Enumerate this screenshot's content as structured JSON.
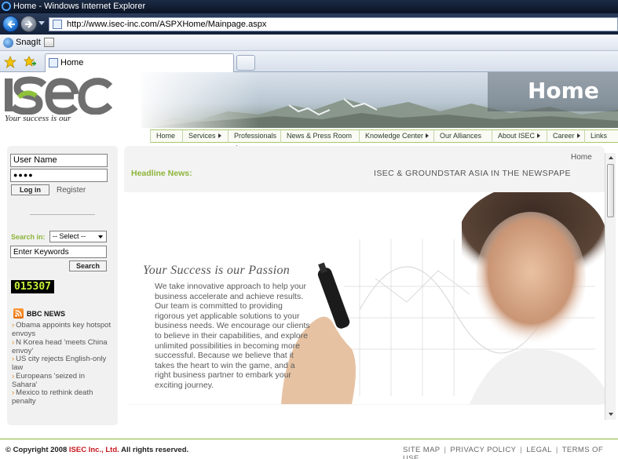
{
  "browser": {
    "window_title": "Home - Windows Internet Explorer",
    "url": "http://www.isec-inc.com/ASPXHome/Mainpage.aspx",
    "toolbar_snagit": "SnagIt",
    "tab_title": "Home"
  },
  "header": {
    "logo_text": "ISEC",
    "tagline": "Your success is our",
    "page_title": "Home"
  },
  "nav": {
    "items": [
      "Home",
      "Services",
      "Professionals",
      "News & Press Room",
      "Knowledge Center",
      "Our Alliances",
      "About ISEC",
      "Career",
      "Links"
    ]
  },
  "login": {
    "username_value": "User Name",
    "password_value": "●●●●",
    "login_button": "Log in",
    "register_link": "Register"
  },
  "search": {
    "label": "Search in:",
    "select_value": "-- Select --",
    "keywords_value": "Enter Keywords",
    "button": "Search"
  },
  "counter": "015307",
  "bbc": {
    "heading": "BBC NEWS",
    "items": [
      "Obama appoints key hotspot envoys",
      "N Korea head 'meets China envoy'",
      "US city rejects English-only law",
      "Europeans 'seized in Sahara'",
      "Mexico to rethink death penalty"
    ]
  },
  "content": {
    "breadcrumb": "Home",
    "headline_label": "Headline News:",
    "headline_text": "ISEC & GROUNDSTAR ASIA IN THE NEWSPAPE",
    "slogan": "Your Success is our Passion",
    "paragraph_1": "We take innovative approach to help your business accelerate and achieve results.",
    "paragraph_2": "Our team is committed to providing rigorous yet applicable solutions to your business needs. We encourage our clients to believe in their capabilities, and explore unlimited possibilities in becoming more successful. Because we believe that it takes the heart to win the game, and a right business partner to embark your exciting journey."
  },
  "footer": {
    "copyright_prefix": "© Copyright 2008",
    "company": "ISEC Inc., Ltd.",
    "copyright_suffix": "All rights reserved.",
    "links": [
      "SITE MAP",
      "PRIVACY POLICY",
      "LEGAL",
      "TERMS OF USE"
    ]
  },
  "colors": {
    "accent_green": "#8db53a",
    "counter_text": "#c6f03a",
    "company_red": "#c8161d"
  }
}
